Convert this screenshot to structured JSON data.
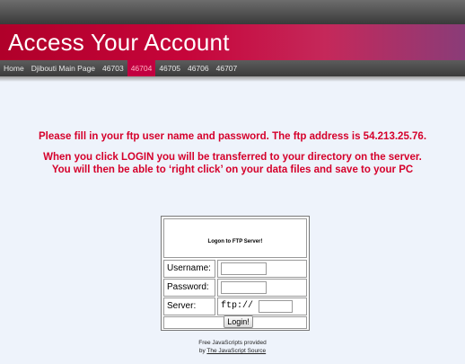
{
  "header": {
    "title": "Access Your Account"
  },
  "nav": {
    "items": [
      {
        "label": "Home"
      },
      {
        "label": "Djibouti Main Page"
      },
      {
        "label": "46703"
      },
      {
        "label": "46704"
      },
      {
        "label": "46705"
      },
      {
        "label": "46706"
      },
      {
        "label": "46707"
      }
    ],
    "active_index": 3
  },
  "messages": {
    "line1": "Please fill in your ftp user name and password. The ftp address is 54.213.25.76.",
    "line2": "When you click LOGIN you will be transferred to your directory on the server.",
    "line3": "You will then be able to ‘right click’ on your data files and save to your PC"
  },
  "login": {
    "heading": "Logon to FTP Server!",
    "username_label": "Username:",
    "username_value": "",
    "password_label": "Password:",
    "password_value": "",
    "server_label": "Server:",
    "server_prefix": "ftp://",
    "server_value": "",
    "button_label": "Login!"
  },
  "footer": {
    "line1": "Free JavaScripts provided",
    "by": "by",
    "link_text": "The JavaScript Source"
  },
  "colors": {
    "accent": "#d5002b",
    "banner_start": "#b0002a",
    "banner_end": "#8a3c78",
    "page_bg": "#eef3fb"
  }
}
